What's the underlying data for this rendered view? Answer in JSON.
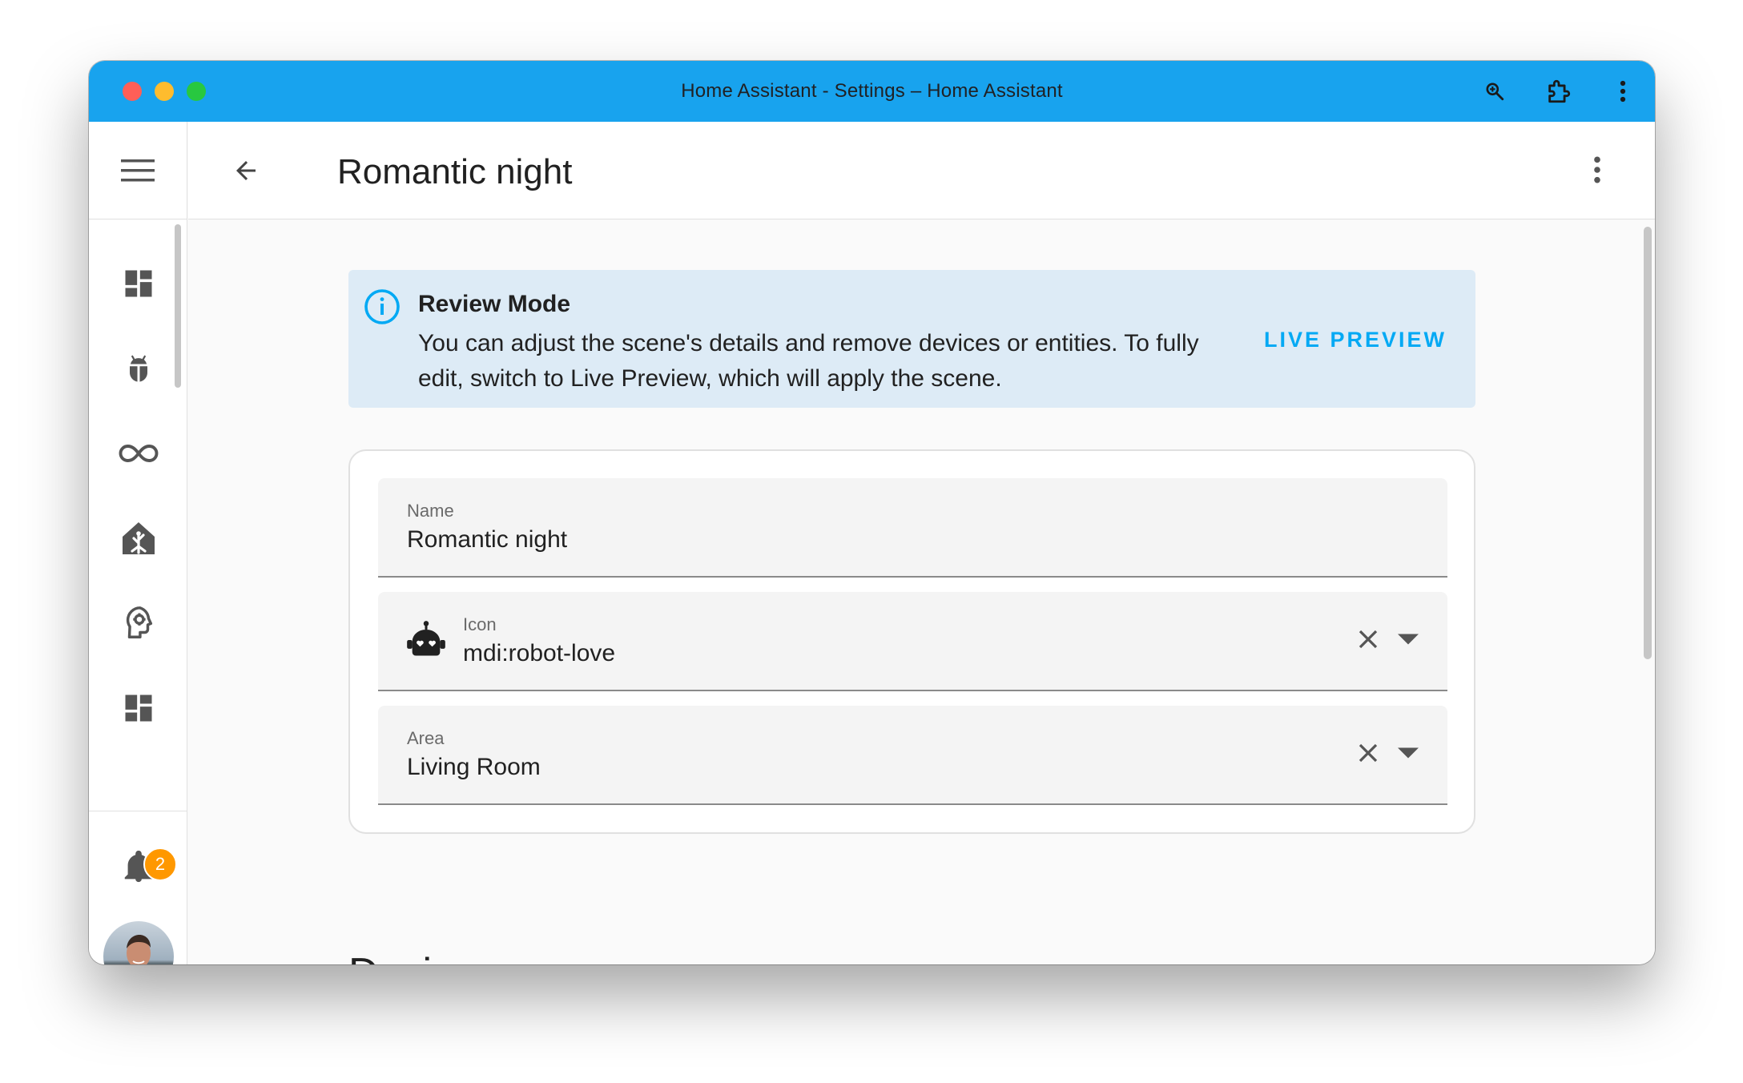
{
  "window": {
    "title": "Home Assistant - Settings – Home Assistant"
  },
  "titlebar_icons": [
    "zoom-icon",
    "extension-icon",
    "kebab-menu-icon"
  ],
  "sidebar": {
    "items": [
      {
        "icon": "dashboard-icon"
      },
      {
        "icon": "bug-icon"
      },
      {
        "icon": "infinity-icon"
      },
      {
        "icon": "home-assistant-icon"
      },
      {
        "icon": "head-cog-icon"
      },
      {
        "icon": "dashboard-icon"
      }
    ],
    "notifications": {
      "icon": "bell-icon",
      "count": "2"
    },
    "avatar": "user-avatar"
  },
  "toolbar": {
    "title": "Romantic night"
  },
  "alert": {
    "title": "Review Mode",
    "message": "You can adjust the scene's details and remove devices or entities. To fully edit, switch to Live Preview, which will apply the scene.",
    "action": "LIVE PREVIEW",
    "color": "#03a9f4"
  },
  "form": {
    "name": {
      "label": "Name",
      "value": "Romantic night"
    },
    "icon": {
      "label": "Icon",
      "value": "mdi:robot-love"
    },
    "area": {
      "label": "Area",
      "value": "Living Room"
    }
  },
  "devices": {
    "title": "Devices"
  }
}
